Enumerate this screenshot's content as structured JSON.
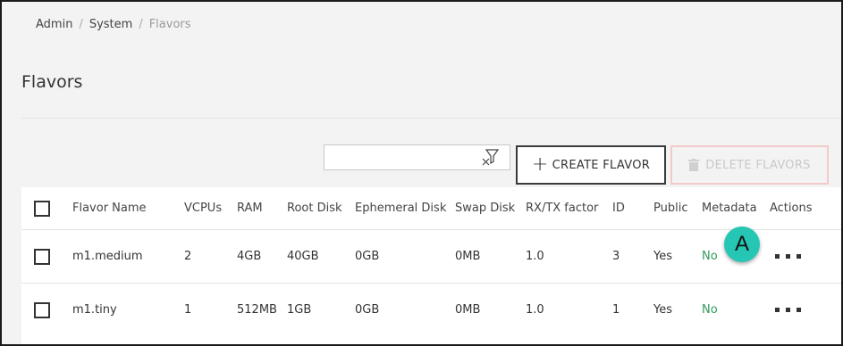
{
  "breadcrumb": {
    "items": [
      "Admin",
      "System"
    ],
    "current": "Flavors",
    "separator": "/"
  },
  "page": {
    "title": "Flavors"
  },
  "toolbar": {
    "search_value": "",
    "create_label": "CREATE FLAVOR",
    "delete_label": "DELETE FLAVORS"
  },
  "table": {
    "columns": [
      "Flavor Name",
      "VCPUs",
      "RAM",
      "Root Disk",
      "Ephemeral Disk",
      "Swap Disk",
      "RX/TX factor",
      "ID",
      "Public",
      "Metadata",
      "Actions"
    ],
    "rows": [
      {
        "name": "m1.medium",
        "vcpus": "2",
        "ram": "4GB",
        "root_disk": "40GB",
        "ephemeral_disk": "0GB",
        "swap_disk": "0MB",
        "rxtx": "1.0",
        "id": "3",
        "public": "Yes",
        "metadata": "No"
      },
      {
        "name": "m1.tiny",
        "vcpus": "1",
        "ram": "512MB",
        "root_disk": "1GB",
        "ephemeral_disk": "0GB",
        "swap_disk": "0MB",
        "rxtx": "1.0",
        "id": "1",
        "public": "Yes",
        "metadata": "No"
      }
    ]
  },
  "annotation": {
    "marker_label": "A"
  },
  "colors": {
    "accent_marker": "#26c6b4",
    "metadata_no": "#2e9b59",
    "delete_border": "#f3c9c9"
  }
}
